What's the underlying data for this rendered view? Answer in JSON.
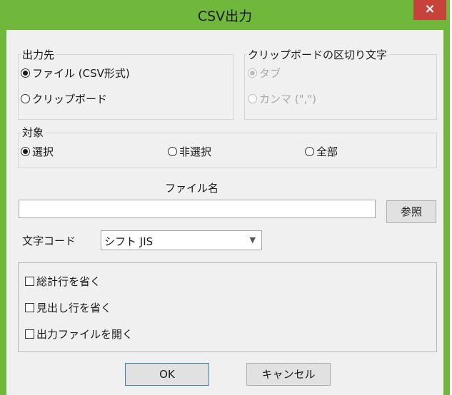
{
  "window": {
    "title": "CSV出力",
    "close_icon": "×"
  },
  "output_dest": {
    "legend": "出力先",
    "options": [
      {
        "label": "ファイル (CSV形式)",
        "checked": true
      },
      {
        "label": "クリップボード",
        "checked": false
      }
    ]
  },
  "clipboard_sep": {
    "legend": "クリップボードの区切り文字",
    "options": [
      {
        "label": "タブ",
        "checked": true,
        "disabled": true
      },
      {
        "label": "カンマ (\",\")",
        "checked": false,
        "disabled": true
      }
    ]
  },
  "target": {
    "legend": "対象",
    "options": [
      {
        "label": "選択",
        "checked": true
      },
      {
        "label": "非選択",
        "checked": false
      },
      {
        "label": "全部",
        "checked": false
      }
    ]
  },
  "filename": {
    "label": "ファイル名",
    "value": "",
    "browse_label": "参照"
  },
  "encoding": {
    "label": "文字コード",
    "selected": "シフト JIS"
  },
  "checkboxes": [
    {
      "label": "総計行を省く",
      "checked": false
    },
    {
      "label": "見出し行を省く",
      "checked": false
    },
    {
      "label": "出力ファイルを開く",
      "checked": false
    }
  ],
  "buttons": {
    "ok": "OK",
    "cancel": "キャンセル"
  },
  "colors": {
    "titlebar": "#6fb83c",
    "close": "#c7423a",
    "dialog_bg": "#f0f0f0"
  }
}
